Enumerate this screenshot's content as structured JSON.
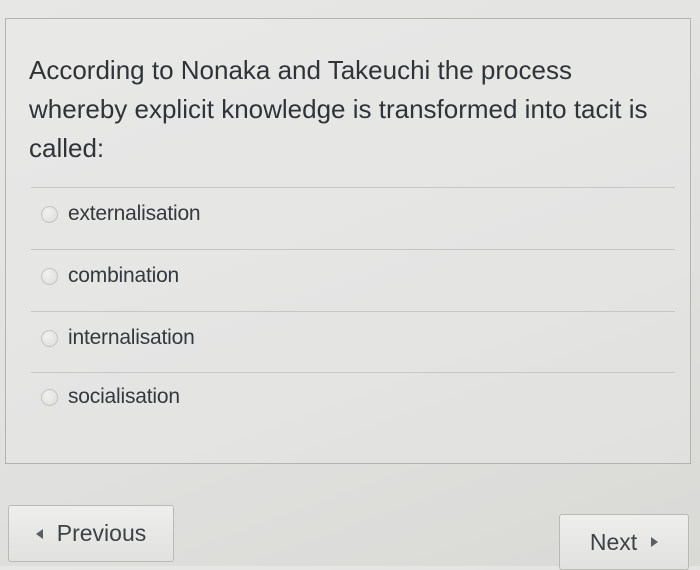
{
  "question": {
    "text": "According to Nonaka and Takeuchi the process whereby explicit knowledge is transformed into tacit is called:"
  },
  "options": [
    {
      "label": "externalisation",
      "selected": false
    },
    {
      "label": "combination",
      "selected": false
    },
    {
      "label": "internalisation",
      "selected": false
    },
    {
      "label": "socialisation",
      "selected": false
    }
  ],
  "navigation": {
    "previous_label": "Previous",
    "next_label": "Next"
  },
  "icons": {
    "previous": "caret-left-icon",
    "next": "caret-right-icon",
    "option": "radio-icon"
  },
  "colors": {
    "background": "#e3e3e1",
    "text": "#303438",
    "border": "#b3b3b0"
  }
}
